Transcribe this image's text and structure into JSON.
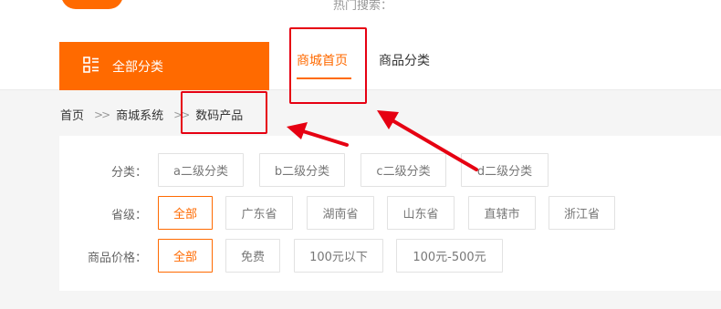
{
  "header": {
    "hot_search_label": "热门搜索："
  },
  "category_button": {
    "label": "全部分类",
    "icon": "category-list-icon",
    "color": "#ff6a00"
  },
  "nav": {
    "home": "商城首页",
    "category": "商品分类"
  },
  "breadcrumb": {
    "items": [
      "首页",
      "商城系统",
      "数码产品"
    ],
    "separator": ">>"
  },
  "filters": {
    "category": {
      "label": "分类：",
      "options": [
        "a二级分类",
        "b二级分类",
        "c二级分类",
        "d二级分类"
      ]
    },
    "province": {
      "label": "省级：",
      "options": [
        "全部",
        "广东省",
        "湖南省",
        "山东省",
        "直辖市",
        "浙江省"
      ],
      "selected": "全部"
    },
    "price": {
      "label": "商品价格：",
      "options": [
        "全部",
        "免费",
        "100元以下",
        "100元-500元"
      ],
      "selected": "全部"
    }
  },
  "colors": {
    "accent": "#ff6a00",
    "annotation": "#e60012"
  }
}
